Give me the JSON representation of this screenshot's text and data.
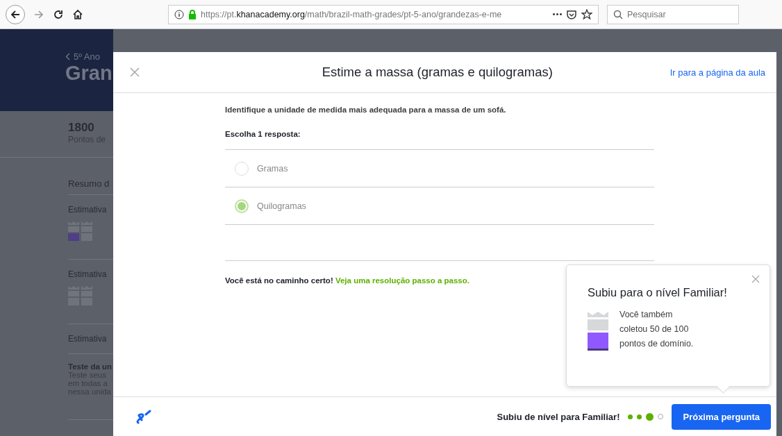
{
  "browser": {
    "url_host_prefix": "https://pt.",
    "url_host": "khanacademy.org",
    "url_path": "/math/brazil-math-grades/pt-5-ano/grandezas-e-me",
    "search": {
      "placeholder": "Pesquisar"
    }
  },
  "background": {
    "breadcrumb": "5º Ano",
    "title": "Gran",
    "points": "1800",
    "points_label": "Pontos de",
    "summary_title": "Resumo d",
    "skills": [
      {
        "title": "Estimativa",
        "cells": [
          {
            "kind": "familiar"
          },
          {
            "kind": "none"
          }
        ]
      },
      {
        "title": "Estimativa",
        "cells": [
          {
            "kind": "none"
          },
          {
            "kind": "none"
          }
        ]
      }
    ],
    "section_title": "Estimativa",
    "test_title": "Teste da un",
    "test_lines": [
      "Teste seus",
      "em todas a",
      "nessa unida"
    ]
  },
  "modal": {
    "title": "Estime a massa (gramas e quilogramas)",
    "link": "Ir para a página da aula",
    "question": "Identifique a unidade de medida mais adequada para a massa de um sofá.",
    "prompt": "Escolha 1 resposta:",
    "choices": [
      {
        "label": "Gramas",
        "selected": false
      },
      {
        "label": "Quilogramas",
        "selected": true
      }
    ],
    "feedback": "Você está no caminho certo!",
    "feedback_link": "Veja uma resolução passo a passo.",
    "footer": {
      "message": "Subiu de nível para Familiar!",
      "progress": [
        {
          "kind": "done"
        },
        {
          "kind": "done"
        },
        {
          "kind": "current"
        },
        {
          "kind": "todo"
        }
      ],
      "next_button": "Próxima pergunta"
    }
  },
  "popup": {
    "title": "Subiu para o nível Familiar!",
    "lines": [
      "Você também",
      "coletou 50 de 100",
      "pontos de domínio."
    ]
  }
}
